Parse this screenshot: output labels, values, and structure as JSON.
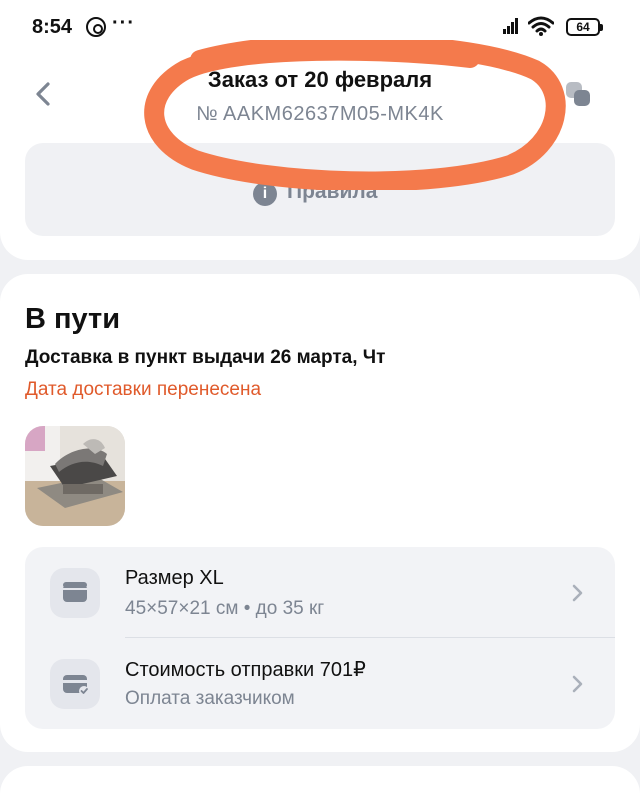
{
  "status_bar": {
    "time": "8:54",
    "dots": "···",
    "battery": "64"
  },
  "header": {
    "title": "Заказ от 20 февраля",
    "order_number": "№ AAKM62637M05-MK4K",
    "rules_label": "Правила",
    "rules_icon_glyph": "i"
  },
  "order": {
    "status": "В пути",
    "delivery": "Доставка в пункт выдачи 26 марта, Чт",
    "notice": "Дата доставки перенесена"
  },
  "details": [
    {
      "title": "Размер XL",
      "subtitle": "45×57×21 см • до 35 кг",
      "icon": "box-icon"
    },
    {
      "title": "Стоимость отправки 701₽",
      "subtitle": "Оплата заказчиком",
      "icon": "card-icon"
    }
  ],
  "colors": {
    "accent_notice": "#e05a2b",
    "annotation": "#f47a4c",
    "muted_text": "#7d8592",
    "background": "#f0f1f4"
  }
}
